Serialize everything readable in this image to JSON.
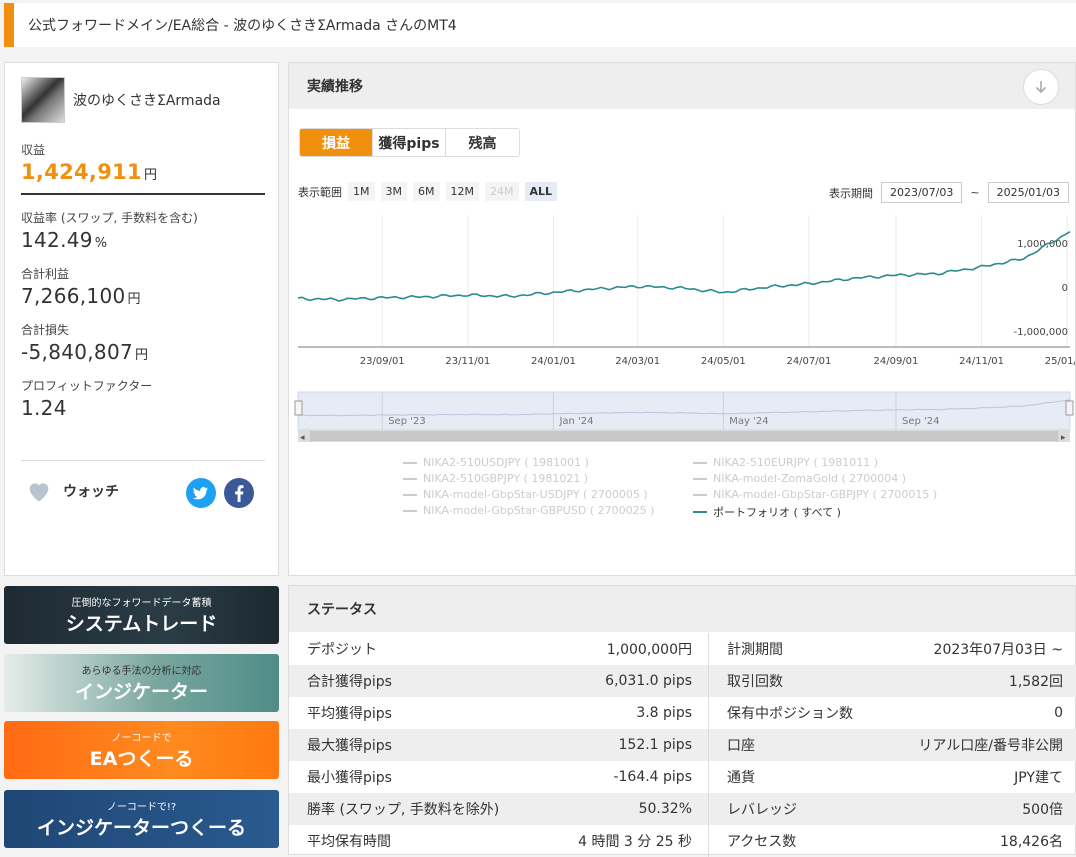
{
  "header": {
    "title": "公式フォワードメイン/EA総合 - 波のゆくさきΣArmada さんのMT4"
  },
  "profile": {
    "username": "波のゆくさきΣArmada",
    "profit_label": "収益",
    "profit_value": "1,424,911",
    "profit_unit": "円",
    "rate_label": "収益率 (スワップ, 手数料を含む)",
    "rate_value": "142.49",
    "rate_unit": "%",
    "gross_profit_label": "合計利益",
    "gross_profit_value": "7,266,100",
    "gross_loss_label": "合計損失",
    "gross_loss_value": "-5,840,807",
    "pf_label": "プロフィットファクター",
    "pf_value": "1.24",
    "yen": "円",
    "watch_label": "ウォッチ"
  },
  "banners": [
    {
      "sub": "圧倒的なフォワードデータ蓄積",
      "main": "システムトレード"
    },
    {
      "sub": "あらゆる手法の分析に対応",
      "main": "インジケーター"
    },
    {
      "sub": "ノーコードで",
      "main": "EAつくーる"
    },
    {
      "sub": "ノーコードで!?",
      "main": "インジケーターつくーる"
    }
  ],
  "chart_panel": {
    "title": "実績推移",
    "tabs": [
      "損益",
      "獲得pips",
      "残高"
    ],
    "range_label": "表示範囲",
    "range_buttons": [
      "1M",
      "3M",
      "6M",
      "12M",
      "24M",
      "ALL"
    ],
    "period_label": "表示期間",
    "period_from": "2023/07/03",
    "period_sep": "~",
    "period_to": "2025/01/03",
    "navigator_labels": [
      "Sep '23",
      "Jan '24",
      "May '24",
      "Sep '24"
    ]
  },
  "chart_data": {
    "type": "line",
    "x_ticks": [
      "23/09/01",
      "23/11/01",
      "24/01/01",
      "24/03/01",
      "24/05/01",
      "24/07/01",
      "24/09/01",
      "24/11/01",
      "25/01/01"
    ],
    "y_ticks": [
      "1,000,000",
      "0",
      "-1,000,000"
    ],
    "ylim": [
      -1200000,
      1800000
    ],
    "series": [
      {
        "name": "ポートフォリオ ( すべて )",
        "color": "#2c8a8f",
        "x": [
          "2023-07-03",
          "2023-08-01",
          "2023-09-01",
          "2023-10-01",
          "2023-11-01",
          "2023-12-01",
          "2024-01-01",
          "2024-02-01",
          "2024-03-01",
          "2024-04-01",
          "2024-05-01",
          "2024-06-01",
          "2024-07-01",
          "2024-08-01",
          "2024-09-01",
          "2024-10-01",
          "2024-11-01",
          "2024-12-01",
          "2025-01-03"
        ],
        "values": [
          -100000,
          -120000,
          -80000,
          -60000,
          -20000,
          -50000,
          40000,
          120000,
          180000,
          140000,
          40000,
          160000,
          240000,
          360000,
          430000,
          470000,
          620000,
          810000,
          1420000
        ]
      }
    ],
    "legend": [
      "NIKA2-510USDJPY ( 1981001 )",
      "NIKA2-510EURJPY ( 1981011 )",
      "NIKA2-510GBPJPY ( 1981021 )",
      "NIKA-model-ZomaGold ( 2700004 )",
      "NIKA-model-GbpStar-USDJPY ( 2700005 )",
      "NIKA-model-GbpStar-GBPJPY ( 2700015 )",
      "NIKA-model-GbpStar-GBPUSD ( 2700025 )",
      "ポートフォリオ ( すべて )"
    ]
  },
  "status": {
    "title": "ステータス",
    "rows": [
      {
        "l1": "デポジット",
        "v1": "1,000,000円",
        "l2": "計測期間",
        "v2": "2023年07月03日 ~"
      },
      {
        "l1": "合計獲得pips",
        "v1": "6,031.0 pips",
        "l2": "取引回数",
        "v2": "1,582回"
      },
      {
        "l1": "平均獲得pips",
        "v1": "3.8 pips",
        "l2": "保有中ポジション数",
        "v2": "0"
      },
      {
        "l1": "最大獲得pips",
        "v1": "152.1 pips",
        "l2": "口座",
        "v2": "リアル口座/番号非公開"
      },
      {
        "l1": "最小獲得pips",
        "v1": "-164.4 pips",
        "l2": "通貨",
        "v2": "JPY建て"
      },
      {
        "l1": "勝率 (スワップ, 手数料を除外)",
        "v1": "50.32%",
        "l2": "レバレッジ",
        "v2": "500倍"
      },
      {
        "l1": "平均保有時間",
        "v1": "4 時間 3 分 25 秒",
        "l2": "アクセス数",
        "v2": "18,426名"
      }
    ]
  }
}
